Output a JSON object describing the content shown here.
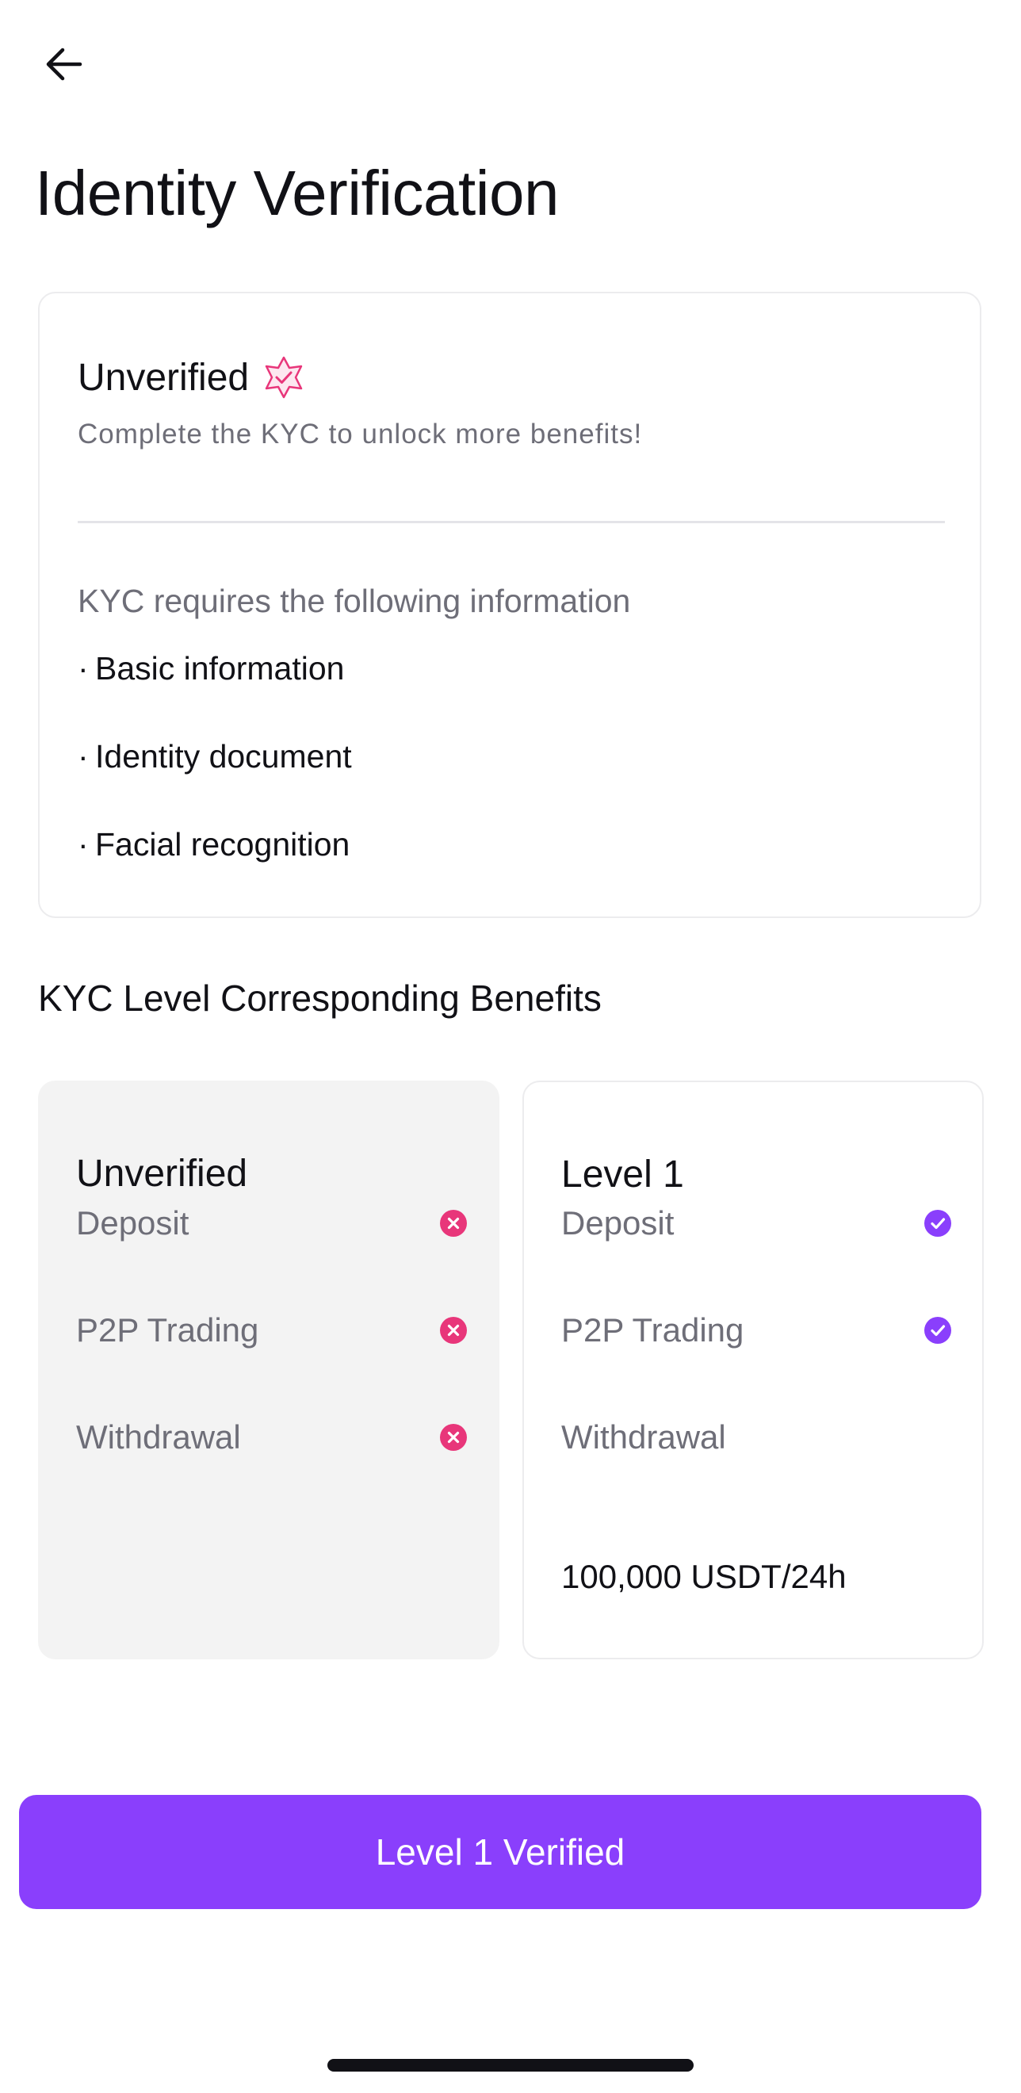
{
  "header": {
    "back_icon": "arrow-left-icon",
    "title": "Identity Verification"
  },
  "status_card": {
    "status": "Unverified",
    "badge_icon": "star-check-badge-icon",
    "badge_color": "#e8367a",
    "description": "Complete the KYC to unlock more benefits!",
    "requirements_intro": "KYC requires the following information",
    "requirements": [
      "Basic information",
      "Identity document",
      "Facial recognition"
    ],
    "bullet": "·"
  },
  "benefits": {
    "title": "KYC Level Corresponding Benefits",
    "levels": [
      {
        "name": "Unverified",
        "items": [
          {
            "label": "Deposit",
            "status": "denied",
            "icon": "x-circle-icon"
          },
          {
            "label": "P2P Trading",
            "status": "denied",
            "icon": "x-circle-icon"
          },
          {
            "label": "Withdrawal",
            "status": "denied",
            "icon": "x-circle-icon"
          }
        ]
      },
      {
        "name": "Level 1",
        "items": [
          {
            "label": "Deposit",
            "status": "allowed",
            "icon": "check-circle-icon"
          },
          {
            "label": "P2P Trading",
            "status": "allowed",
            "icon": "check-circle-icon"
          },
          {
            "label": "Withdrawal",
            "status": "limited"
          }
        ],
        "withdrawal_limit": "100,000 USDT/24h"
      }
    ]
  },
  "cta": {
    "label": "Level 1 Verified"
  },
  "colors": {
    "accent": "#8a3ffc",
    "denied": "#e8367a",
    "allowed": "#8a3ffc",
    "text_primary": "#111116",
    "text_secondary": "#6e6e78"
  }
}
